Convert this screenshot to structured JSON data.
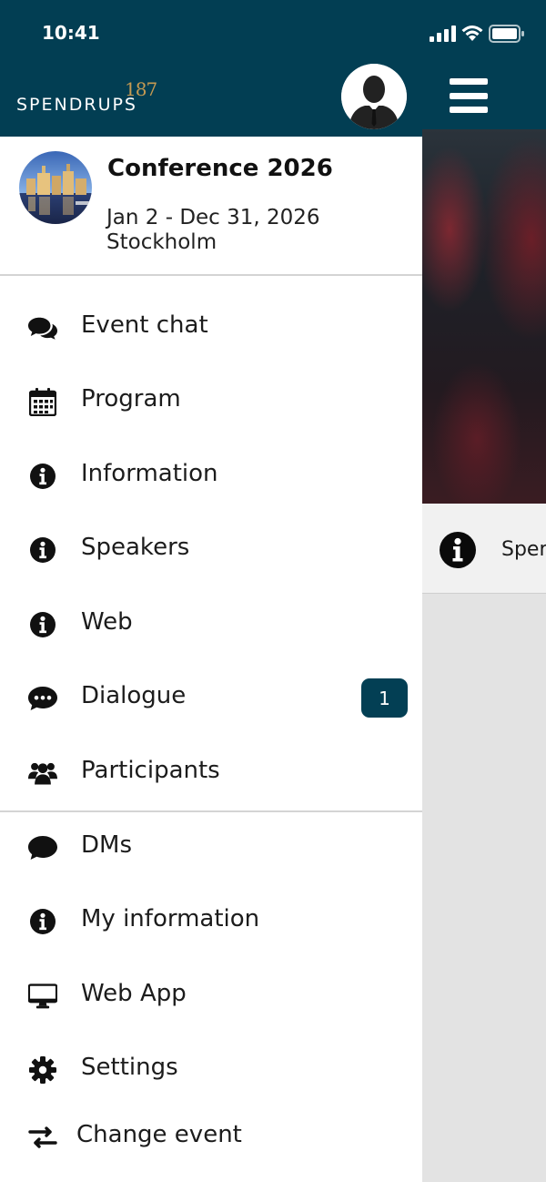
{
  "status_bar": {
    "time": "10:41"
  },
  "brand": {
    "wordmark": "SPENDRUPS",
    "number": "187"
  },
  "event": {
    "title": "Conference 2026",
    "dates": "Jan 2 - Dec 31, 2026",
    "location": "Stockholm"
  },
  "menu": {
    "section1": [
      {
        "label": "Event chat",
        "icon": "chat-bubbles-icon"
      },
      {
        "label": "Program",
        "icon": "calendar-icon"
      },
      {
        "label": "Information",
        "icon": "info-icon"
      },
      {
        "label": "Speakers",
        "icon": "info-icon"
      },
      {
        "label": "Web",
        "icon": "info-icon"
      },
      {
        "label": "Dialogue",
        "icon": "comment-dots-icon",
        "badge": "1"
      },
      {
        "label": "Participants",
        "icon": "users-icon"
      }
    ],
    "section2": [
      {
        "label": "DMs",
        "icon": "comment-icon"
      },
      {
        "label": "My information",
        "icon": "info-icon"
      },
      {
        "label": "Web App",
        "icon": "desktop-icon"
      },
      {
        "label": "Settings",
        "icon": "gear-icon"
      },
      {
        "label": "Change event",
        "icon": "exchange-icon"
      }
    ]
  },
  "background": {
    "row_label": "Sper"
  },
  "colors": {
    "header": "#023e53",
    "badge": "#033f54",
    "brand_number": "#c59a52"
  }
}
